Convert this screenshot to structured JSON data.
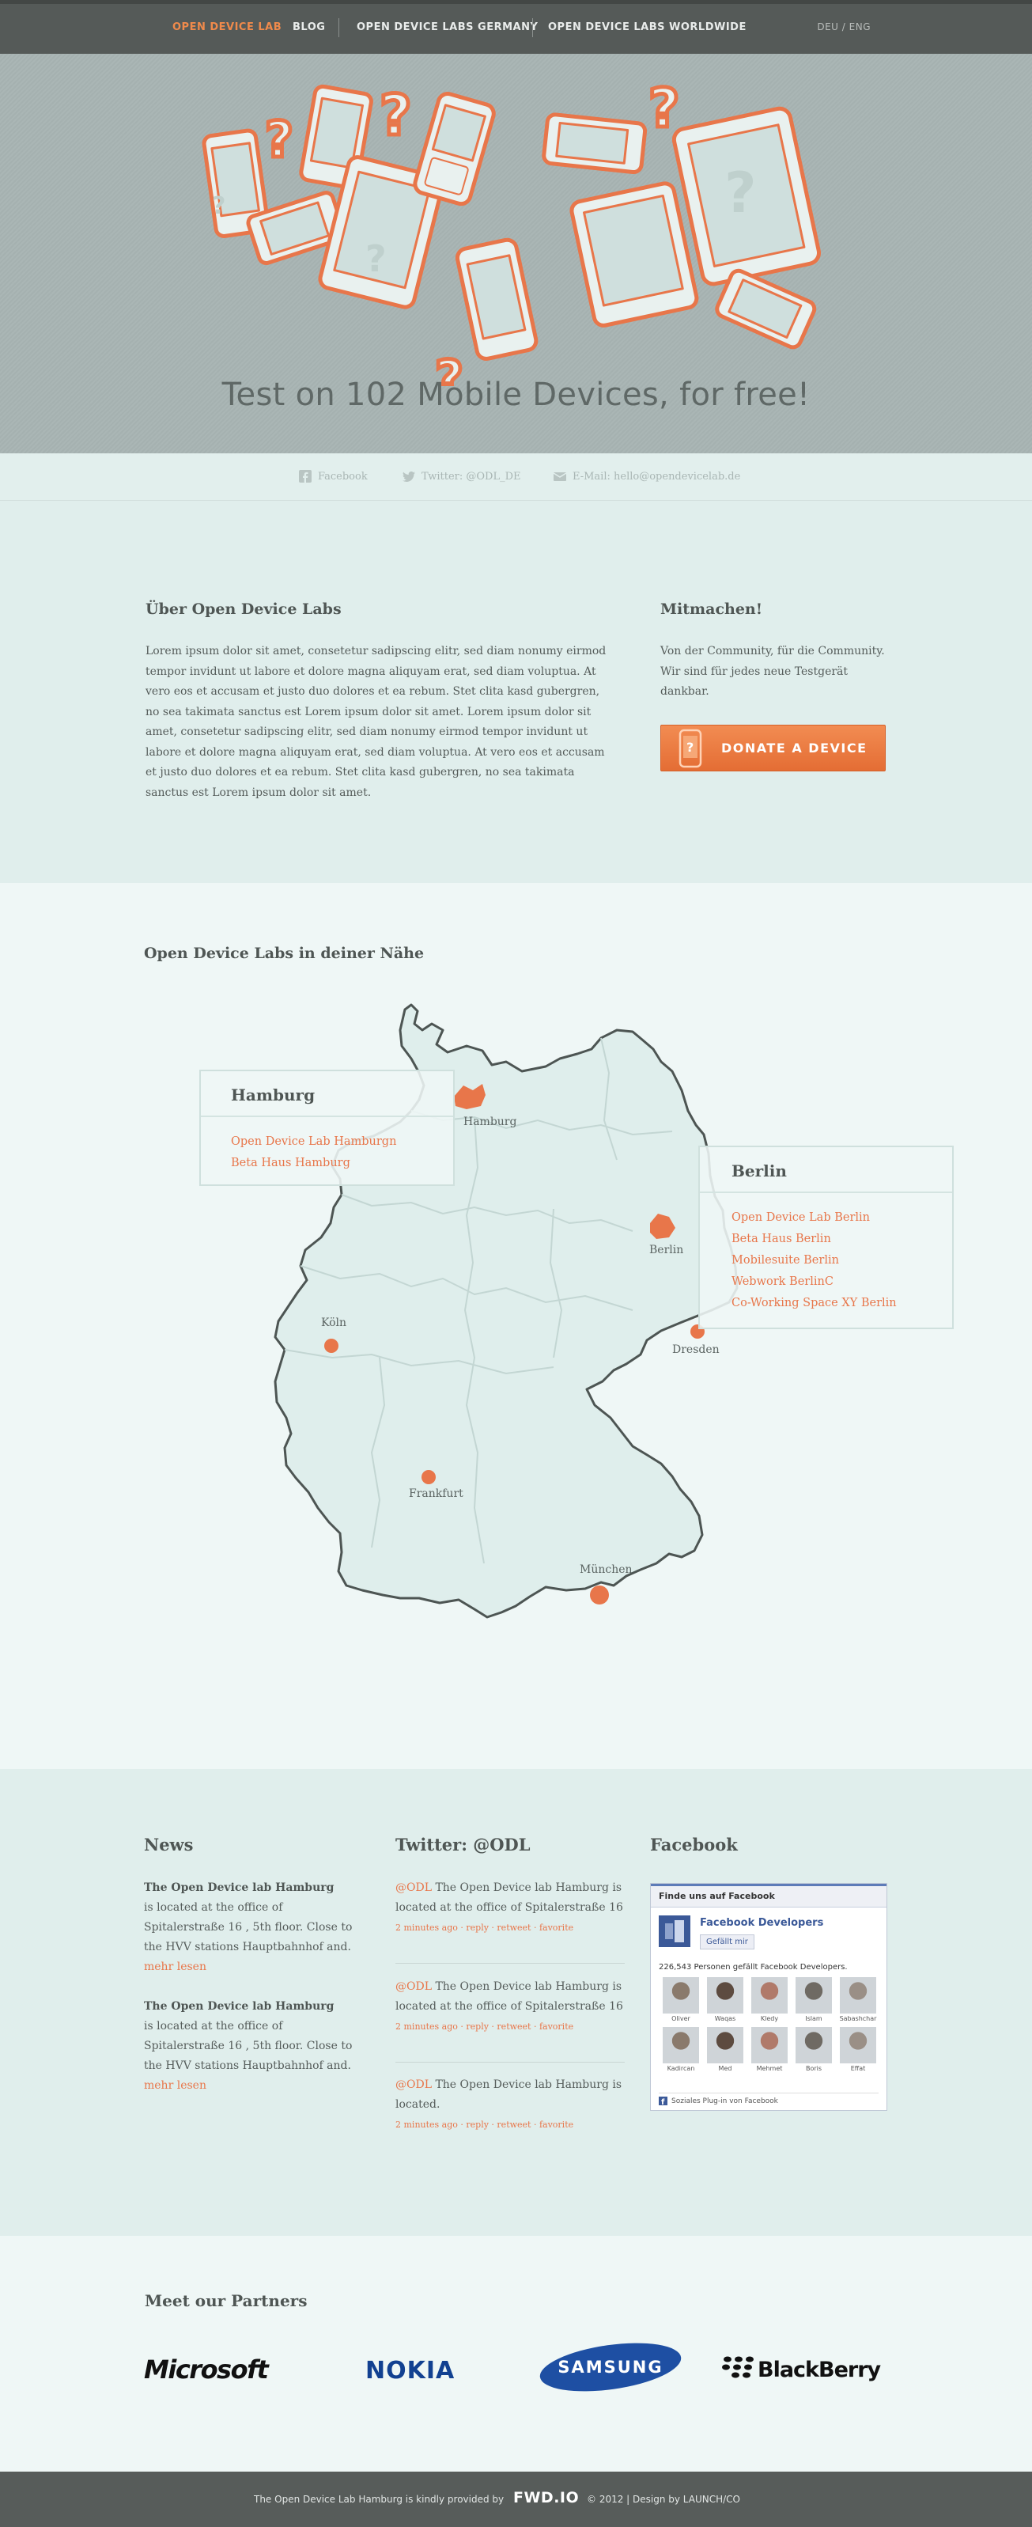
{
  "nav": {
    "brand": "OPEN  DEVICE LAB",
    "blog": "BLOG",
    "germany": "OPEN DEVICE LABS GERMANY",
    "worldwide": "OPEN DEVICE LABS WORLDWIDE",
    "lang": "DEU / ENG"
  },
  "hero": {
    "headline": "Test on 102 Mobile Devices, for free!"
  },
  "social": {
    "facebook": "Facebook",
    "twitter": "Twitter: @ODL_DE",
    "email": "E-Mail: hello@opendevicelab.de"
  },
  "about": {
    "title": "Über Open Device Labs",
    "text": "Lorem ipsum dolor sit amet, consetetur sadipscing elitr, sed diam nonumy eirmod tempor invidunt ut labore et dolore magna aliquyam erat, sed diam voluptua. At vero eos et accusam et justo duo dolores et ea rebum. Stet clita kasd gubergren, no sea takimata sanctus est Lorem ipsum dolor sit amet. Lorem ipsum dolor sit amet, consetetur sadipscing elitr, sed diam nonumy eirmod tempor invidunt ut labore et dolore magna aliquyam erat, sed diam voluptua. At vero eos et accusam et justo duo dolores et ea rebum. Stet clita kasd gubergren, no sea takimata sanctus est Lorem ipsum dolor sit amet."
  },
  "join": {
    "title": "Mitmachen!",
    "text": "Von der Community, für die Community. Wir sind für jedes neue Testgerät dankbar.",
    "button": "DONATE A DEVICE"
  },
  "map": {
    "title": "Open Device Labs in deiner Nähe",
    "cities": {
      "hamburg": "Hamburg",
      "berlin": "Berlin",
      "koeln": "Köln",
      "dresden": "Dresden",
      "frankfurt": "Frankfurt",
      "muenchen": "München"
    },
    "hamburg_card": {
      "title": "Hamburg",
      "labs": [
        "Open Device Lab Hamburgn",
        "Beta Haus Hamburg"
      ]
    },
    "berlin_card": {
      "title": "Berlin",
      "labs": [
        "Open Device Lab Berlin",
        "Beta Haus Berlin",
        "Mobilesuite Berlin",
        "Webwork BerlinC",
        "Co-Working Space XY Berlin"
      ]
    }
  },
  "news": {
    "title": "News",
    "items": [
      {
        "title": "The Open Device lab Hamburg",
        "text": "is located at the office of Spitalerstraße 16 , 5th floor. Close to the HVV stations Hauptbahnhof and.",
        "more": "mehr lesen"
      },
      {
        "title": "The Open Device lab Hamburg",
        "text": "is located at the office of Spitalerstraße 16 , 5th floor. Close to the HVV stations Hauptbahnhof and.",
        "more": "mehr lesen"
      }
    ]
  },
  "twitter": {
    "title": "Twitter: @ODL",
    "tweets": [
      {
        "handle": "@ODL",
        "text": " The Open Device lab Hamburg is located at the office of Spitalerstraße 16",
        "meta": "2 minutes ago · reply · retweet · favorite"
      },
      {
        "handle": "@ODL",
        "text": " The Open Device lab Hamburg is located at the office of Spitalerstraße 16",
        "meta": "2 minutes ago · reply · retweet · favorite"
      },
      {
        "handle": "@ODL",
        "text": " The Open Device lab Hamburg is located.",
        "meta": "2 minutes ago · reply · retweet · favorite"
      }
    ]
  },
  "facebook": {
    "title": "Facebook",
    "widget_header": "Finde uns auf Facebook",
    "page_name": "Facebook Developers",
    "like": "Gefällt mir",
    "count_text": "226,543 Personen gefällt Facebook Developers.",
    "faces": [
      "Oliver",
      "Waqas",
      "Kledy",
      "Islam",
      "Sabashchar",
      "Kadircan",
      "Med",
      "Mehmet",
      "Boris",
      "Effat"
    ],
    "plugin_text": "Soziales Plug-in von Facebook"
  },
  "partners": {
    "title": "Meet our Partners",
    "logos": [
      "Microsoft",
      "NOKIA",
      "SAMSUNG",
      "BlackBerry"
    ]
  },
  "footer": {
    "provided": "The Open Device Lab Hamburg is kindly provided by",
    "brand": "FWD.IO",
    "copyright": "© 2012  |  Design by LAUNCH/CO"
  }
}
